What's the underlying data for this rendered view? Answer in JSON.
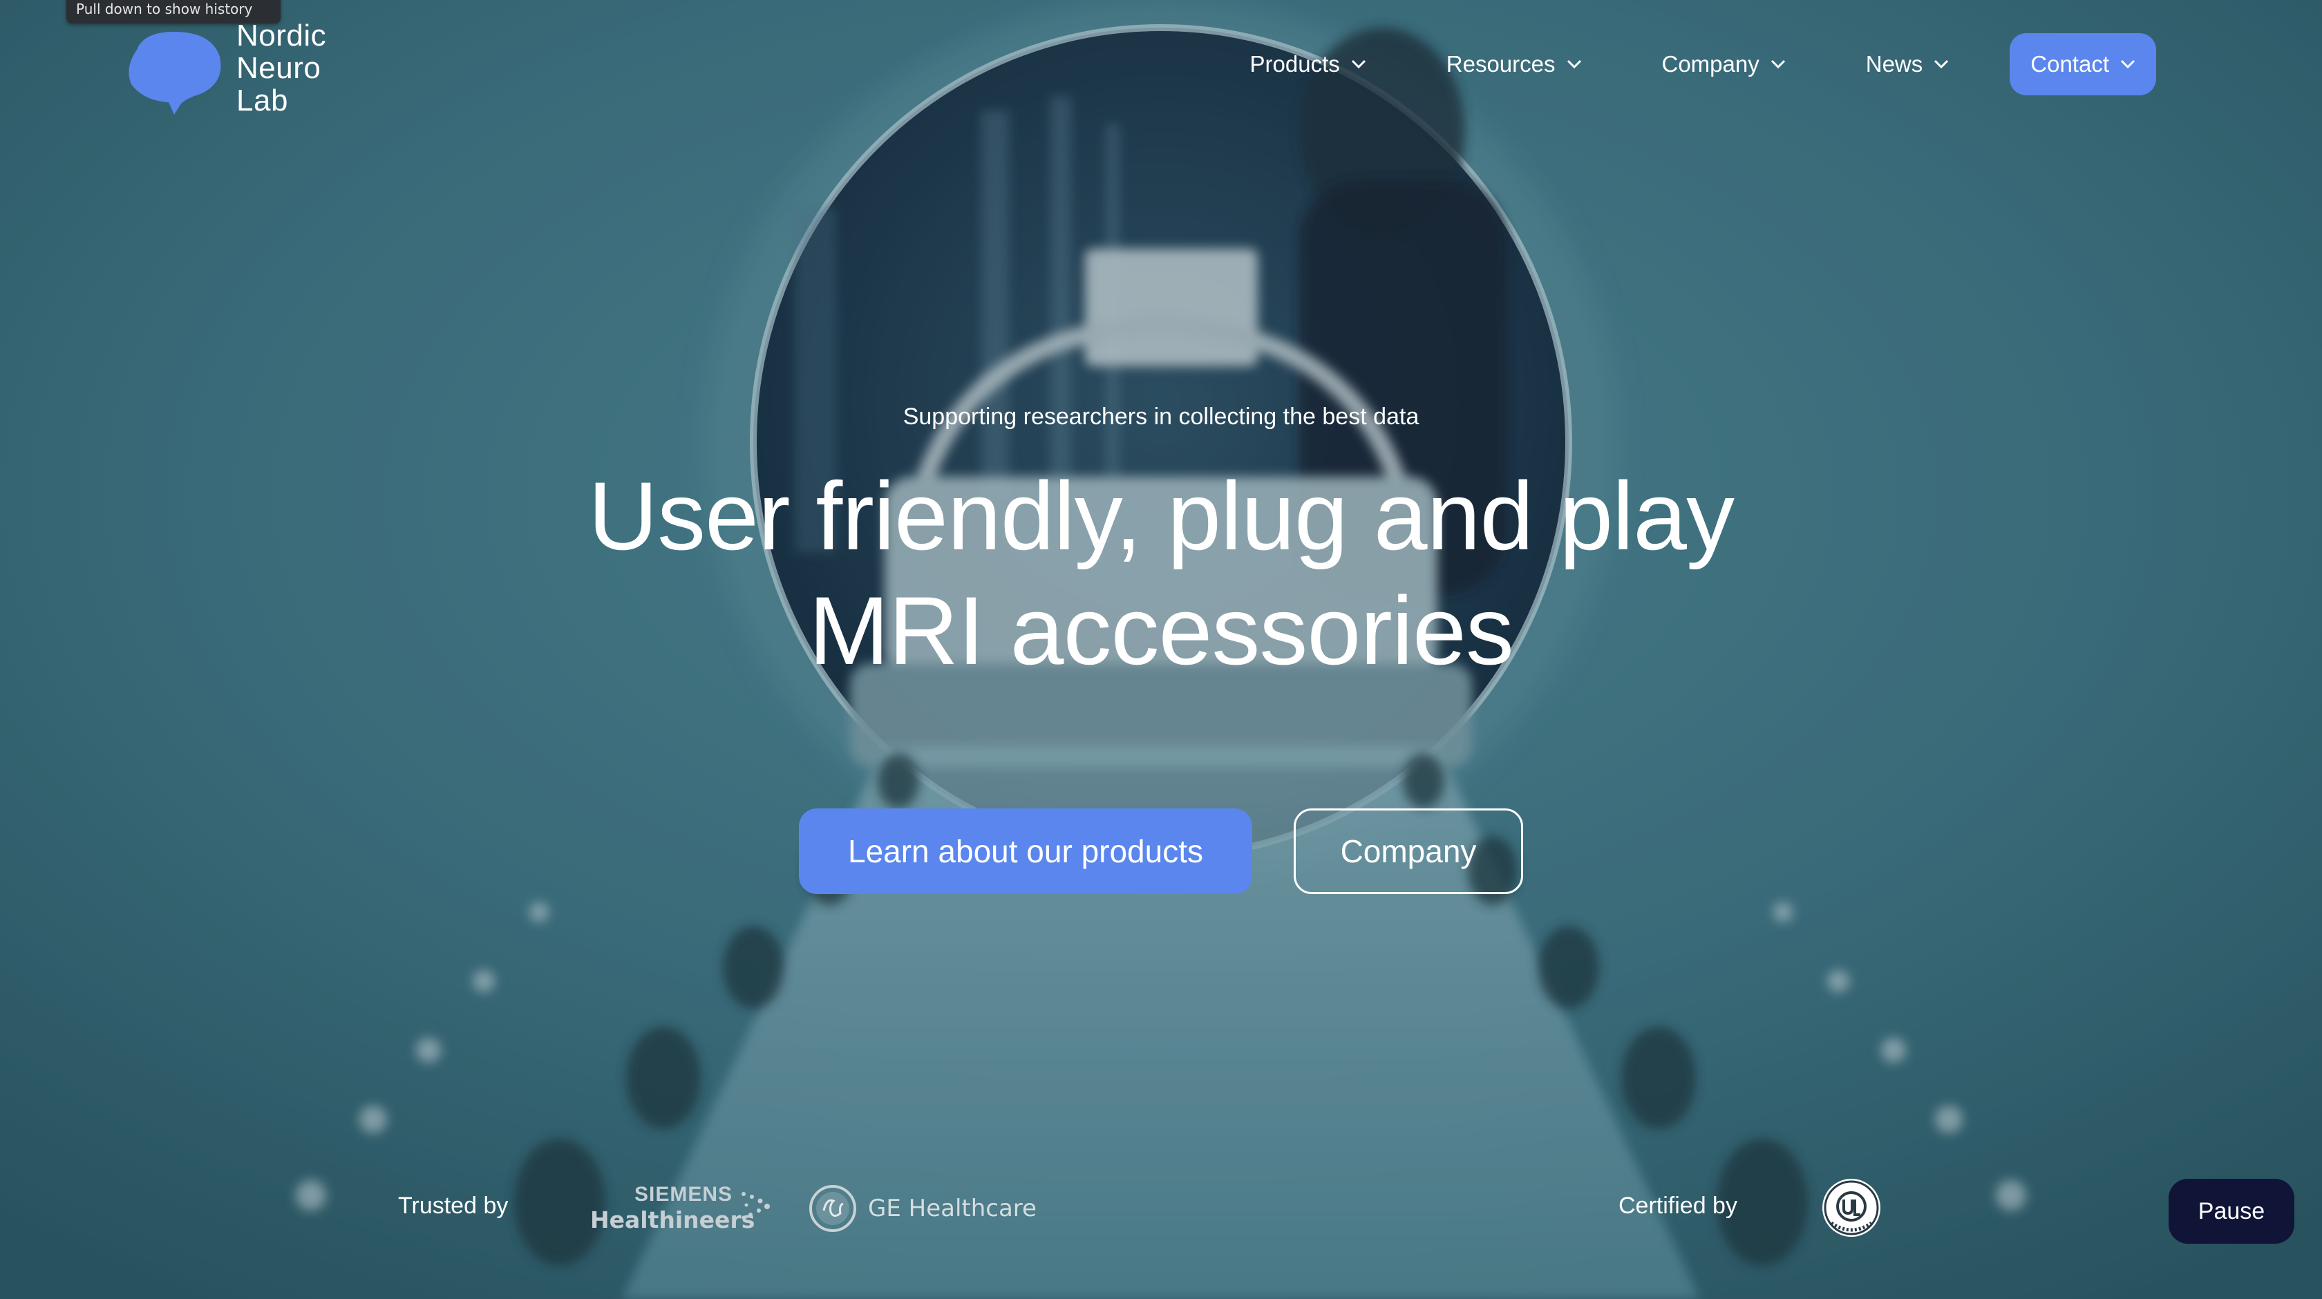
{
  "tooltip": {
    "hint": "Pull down to show history"
  },
  "brand": {
    "line1": "Nordic",
    "line2": "Neuro",
    "line3": "Lab"
  },
  "nav": {
    "items": [
      {
        "label": "Products"
      },
      {
        "label": "Resources"
      },
      {
        "label": "Company"
      },
      {
        "label": "News"
      }
    ],
    "contact_label": "Contact"
  },
  "hero": {
    "kicker": "Supporting researchers in collecting the best data",
    "title_line1": "User friendly, plug and play",
    "title_line2": "MRI accessories",
    "primary_cta": "Learn about our products",
    "secondary_cta": "Company"
  },
  "footer_strip": {
    "trusted_label": "Trusted by",
    "siemens_line1": "SIEMENS",
    "siemens_line2": "Healthineers",
    "ge_label": "GE Healthcare",
    "certified_label": "Certified by",
    "pause_label": "Pause"
  },
  "colors": {
    "accent": "#5a86ee",
    "pause_bg": "#101538",
    "scene": "#3d6f7b"
  },
  "icons": [
    "brain-logo-icon",
    "chevron-down-icon",
    "siemens-dots-icon",
    "ge-logo-icon",
    "ul-certified-icon"
  ]
}
